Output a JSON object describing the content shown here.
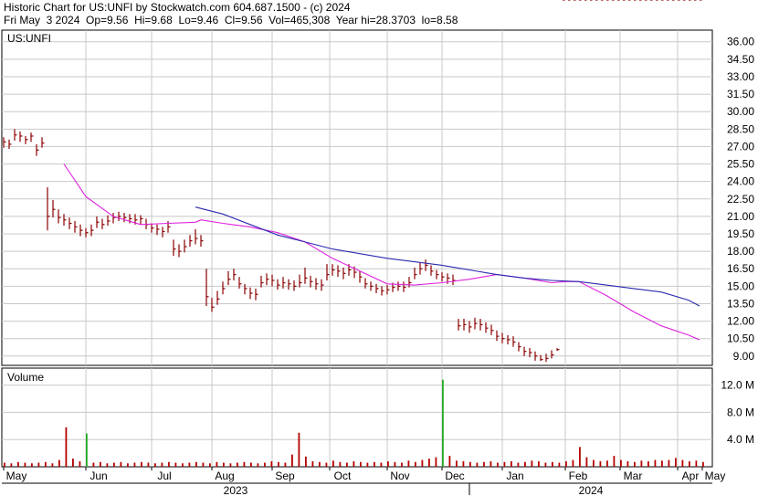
{
  "header": {
    "line1": "Historic Chart for US:UNFI by Stockwatch.com 604.687.1500 - (c) 2024",
    "line2": "Fri May  3 2024  Op=9.56  Hi=9.68  Lo=9.46  Cl=9.56  Vol=465,308  Year hi=28.3703  lo=8.58"
  },
  "colors": {
    "bars": "#8b0000",
    "ma_short": "#dd22dd",
    "ma_long": "#2a2ab0",
    "vol_normal": "#b40000",
    "vol_up": "#22aa22",
    "grid": "#c8c8c8"
  },
  "chart_data": [
    {
      "type": "line",
      "title": "US:UNFI",
      "ylim": [
        8.2,
        37.0
      ],
      "yticks": [
        36.0,
        34.5,
        33.0,
        31.5,
        30.0,
        28.5,
        27.0,
        25.5,
        24.0,
        22.5,
        21.0,
        19.5,
        18.0,
        16.5,
        15.0,
        13.5,
        12.0,
        10.5,
        9.0
      ],
      "ytick_labels": [
        "36.00",
        "34.50",
        "33.00",
        "31.50",
        "30.00",
        "28.50",
        "27.00",
        "25.50",
        "24.00",
        "22.50",
        "21.00",
        "19.50",
        "18.00",
        "16.50",
        "15.00",
        "13.50",
        "12.00",
        "10.50",
        "9.00"
      ],
      "x_months": [
        "May",
        "Jun",
        "Jul",
        "Aug",
        "Sep",
        "Oct",
        "Nov",
        "Dec",
        "Jan",
        "Feb",
        "Mar",
        "Apr",
        "May"
      ],
      "x_years": [
        "2023",
        "2024"
      ],
      "grid": true,
      "series": [
        {
          "kind": "price_hlc_bars",
          "x": [
            0,
            2,
            4,
            6,
            8,
            10,
            12,
            14,
            16,
            18,
            20,
            22,
            24,
            26,
            28,
            30,
            32,
            34,
            36,
            38,
            40,
            42,
            44,
            46,
            48,
            50,
            52,
            54,
            56,
            58,
            60,
            62,
            64,
            66,
            68,
            70,
            72,
            74,
            76,
            78,
            80,
            82,
            84,
            86,
            88,
            90,
            92,
            94,
            96,
            98,
            100,
            102,
            104,
            106,
            108,
            110,
            112,
            114,
            116,
            118,
            120,
            122,
            124,
            126,
            128,
            130,
            132,
            134,
            136,
            138,
            140,
            142,
            144,
            146,
            148,
            150,
            152,
            154,
            156,
            158,
            160,
            162,
            164,
            166,
            168,
            170,
            172,
            174,
            176,
            178,
            180,
            182,
            184,
            186,
            188,
            190,
            192,
            194,
            196,
            198,
            200,
            202,
            204,
            206,
            208,
            210,
            212,
            214,
            216,
            218,
            220,
            222,
            224,
            226,
            228,
            230,
            232,
            234,
            236,
            238,
            240,
            242,
            244,
            246,
            248,
            250,
            252,
            254
          ],
          "close": [
            27.4,
            27.2,
            28.0,
            27.9,
            27.6,
            27.9,
            26.7,
            27.3,
            21.0,
            21.6,
            20.9,
            20.7,
            20.4,
            20.1,
            19.8,
            19.6,
            19.8,
            20.5,
            20.3,
            20.6,
            20.9,
            21.0,
            20.9,
            20.8,
            20.7,
            20.8,
            20.3,
            20.0,
            19.9,
            19.7,
            20.1,
            18.2,
            18.0,
            18.4,
            18.9,
            19.1,
            18.9,
            14.1,
            13.2,
            13.9,
            14.8,
            15.6,
            16.0,
            15.2,
            14.8,
            14.4,
            14.3,
            15.3,
            15.6,
            15.5,
            15.1,
            15.3,
            15.2,
            15.0,
            15.3,
            15.7,
            15.4,
            15.2,
            15.1,
            16.0,
            16.4,
            16.3,
            16.1,
            16.4,
            16.2,
            15.8,
            15.2,
            15.0,
            14.8,
            14.6,
            14.7,
            14.9,
            15.0,
            14.9,
            15.3,
            16.0,
            16.5,
            16.8,
            16.3,
            16.0,
            15.8,
            15.7,
            15.5,
            11.6,
            11.7,
            11.5,
            11.8,
            11.7,
            11.4,
            11.2,
            10.7,
            10.5,
            10.4,
            10.2,
            9.8,
            9.4,
            9.3,
            9.0,
            8.7,
            8.8,
            9.1,
            9.56
          ],
          "high": [
            27.8,
            27.6,
            28.5,
            28.3,
            27.9,
            28.2,
            27.2,
            27.8,
            23.5,
            22.4,
            21.6,
            21.2,
            20.9,
            20.6,
            20.3,
            20.0,
            20.3,
            21.0,
            20.8,
            21.1,
            21.3,
            21.4,
            21.3,
            21.2,
            21.2,
            21.1,
            20.8,
            20.4,
            20.3,
            20.1,
            20.6,
            19.0,
            18.6,
            19.0,
            19.4,
            19.9,
            19.4,
            16.5,
            14.0,
            14.6,
            15.4,
            16.3,
            16.5,
            15.8,
            15.2,
            14.9,
            14.8,
            15.9,
            16.1,
            16.0,
            15.6,
            15.8,
            15.6,
            15.5,
            16.0,
            16.6,
            15.9,
            15.7,
            15.6,
            16.9,
            16.9,
            16.8,
            16.6,
            16.9,
            16.7,
            16.3,
            15.7,
            15.4,
            15.2,
            15.0,
            15.1,
            15.3,
            15.4,
            15.4,
            15.8,
            16.6,
            17.0,
            17.3,
            16.8,
            16.4,
            16.2,
            16.1,
            16.0,
            12.2,
            12.2,
            12.0,
            12.3,
            12.2,
            11.9,
            11.7,
            11.2,
            11.0,
            10.8,
            10.7,
            10.2,
            9.8,
            9.7,
            9.4,
            9.1,
            9.2,
            9.5,
            9.68
          ],
          "low": [
            26.9,
            26.8,
            27.5,
            27.4,
            27.2,
            27.4,
            26.2,
            26.9,
            19.8,
            20.9,
            20.4,
            20.2,
            19.9,
            19.6,
            19.3,
            19.2,
            19.3,
            20.0,
            19.9,
            20.2,
            20.4,
            20.6,
            20.5,
            20.4,
            20.3,
            20.3,
            19.9,
            19.6,
            19.4,
            19.2,
            19.6,
            17.6,
            17.5,
            17.9,
            18.4,
            18.6,
            18.4,
            13.3,
            12.8,
            13.4,
            14.3,
            15.1,
            15.5,
            14.8,
            14.3,
            13.9,
            13.8,
            14.9,
            15.1,
            15.0,
            14.7,
            14.8,
            14.7,
            14.6,
            14.9,
            15.2,
            14.9,
            14.7,
            14.6,
            15.5,
            15.9,
            15.8,
            15.6,
            15.9,
            15.7,
            15.3,
            14.8,
            14.6,
            14.4,
            14.2,
            14.3,
            14.5,
            14.6,
            14.5,
            14.9,
            15.6,
            16.0,
            16.3,
            15.9,
            15.6,
            15.4,
            15.2,
            15.1,
            11.2,
            11.2,
            11.0,
            11.3,
            11.2,
            11.0,
            10.8,
            10.3,
            10.1,
            10.0,
            9.8,
            9.4,
            9.0,
            8.9,
            8.6,
            8.58,
            8.5,
            8.8,
            9.46
          ]
        },
        {
          "kind": "ma_short",
          "x": [
            22,
            30,
            40,
            50,
            60,
            70,
            72,
            80,
            90,
            100,
            110,
            120,
            130,
            140,
            150,
            160,
            170,
            180,
            190,
            200,
            205,
            210,
            220,
            230,
            240,
            250,
            254
          ],
          "values": [
            25.5,
            22.7,
            21.0,
            20.3,
            20.4,
            20.5,
            20.7,
            20.4,
            20.1,
            19.6,
            18.8,
            17.4,
            16.3,
            15.2,
            15.1,
            15.3,
            15.6,
            16.0,
            15.7,
            15.3,
            15.4,
            15.4,
            14.2,
            12.8,
            11.6,
            10.8,
            10.4
          ]
        },
        {
          "kind": "ma_long",
          "x": [
            70,
            80,
            90,
            100,
            110,
            120,
            130,
            140,
            150,
            160,
            170,
            180,
            190,
            200,
            210,
            220,
            230,
            240,
            250,
            254
          ],
          "values": [
            21.8,
            21.2,
            20.3,
            19.4,
            18.8,
            18.2,
            17.8,
            17.4,
            17.1,
            16.8,
            16.4,
            16.0,
            15.7,
            15.5,
            15.4,
            15.1,
            14.8,
            14.5,
            13.8,
            13.3
          ]
        }
      ]
    },
    {
      "type": "bar",
      "title": "Volume",
      "ylim": [
        0,
        14.5
      ],
      "yticks": [
        4.0,
        8.0,
        12.0
      ],
      "ytick_labels": [
        "4.0 M",
        "8.0 M",
        "12.0 M"
      ],
      "values": [
        0.6,
        0.5,
        0.7,
        0.6,
        0.5,
        0.6,
        0.7,
        0.5,
        1.0,
        5.8,
        1.2,
        0.8,
        4.9,
        0.6,
        0.7,
        0.5,
        0.6,
        0.7,
        0.5,
        0.6,
        0.7,
        0.6,
        0.5,
        0.6,
        0.7,
        0.6,
        0.5,
        0.6,
        0.7,
        0.6,
        0.5,
        0.7,
        0.6,
        0.5,
        0.6,
        0.7,
        0.6,
        0.5,
        0.6,
        0.8,
        0.7,
        0.6,
        1.8,
        5.0,
        1.5,
        0.8,
        0.7,
        0.6,
        0.9,
        0.7,
        0.6,
        0.8,
        0.7,
        0.6,
        0.7,
        0.6,
        0.8,
        0.7,
        0.6,
        0.9,
        0.7,
        1.0,
        1.2,
        1.4,
        12.8,
        1.6,
        0.9,
        0.8,
        0.7,
        0.6,
        0.7,
        0.8,
        0.6,
        0.7,
        0.8,
        0.6,
        0.7,
        0.9,
        0.8,
        0.6,
        0.7,
        0.6,
        0.8,
        1.0,
        2.9,
        1.4,
        1.0,
        0.8,
        0.9,
        1.6,
        1.0,
        0.8,
        0.7,
        0.9,
        0.8,
        1.0,
        0.9,
        1.0,
        1.3,
        1.0,
        0.8,
        0.9,
        0.7
      ],
      "up_days": [
        12,
        43,
        64,
        89
      ]
    }
  ]
}
